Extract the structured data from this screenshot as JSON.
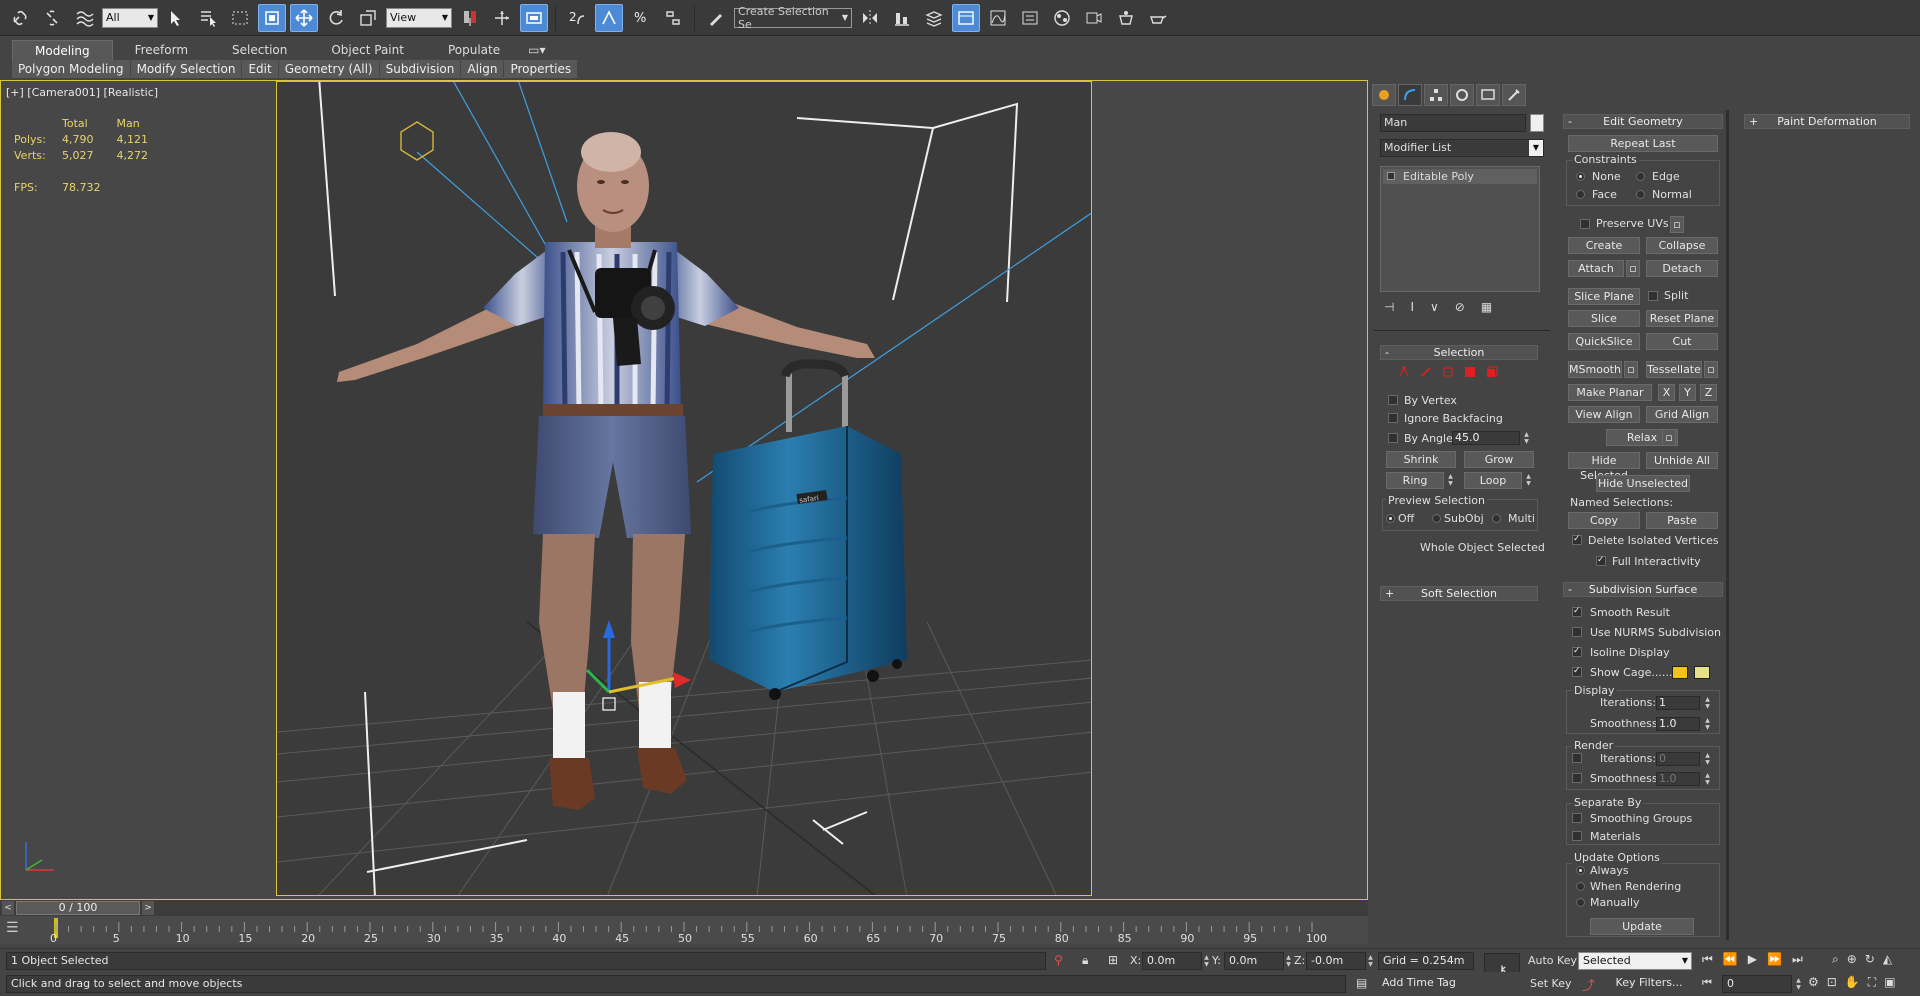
{
  "toolbar": {
    "selection_filter": "All",
    "reference_coord": "View",
    "named_selection_placeholder": "Create Selection Se"
  },
  "ribbon": {
    "tabs": [
      "Modeling",
      "Freeform",
      "Selection",
      "Object Paint",
      "Populate"
    ],
    "sub_items": [
      "Polygon Modeling",
      "Modify Selection",
      "Edit",
      "Geometry (All)",
      "Subdivision",
      "Align",
      "Properties"
    ]
  },
  "viewport": {
    "label": "[+] [Camera001] [Realistic]",
    "stats": {
      "col_total": "Total",
      "col_man": "Man",
      "polys_label": "Polys:",
      "polys_total": "4,790",
      "polys_man": "4,121",
      "verts_label": "Verts:",
      "verts_total": "5,027",
      "verts_man": "4,272",
      "fps_label": "FPS:",
      "fps_value": "78.732"
    },
    "suitcase_brand": "safari"
  },
  "command_panel": {
    "object_name": "Man",
    "modifier_list": "Modifier List",
    "stack_item": "Editable Poly",
    "selection": {
      "title": "Selection",
      "by_vertex": "By Vertex",
      "ignore_backfacing": "Ignore Backfacing",
      "by_angle": "By Angle:",
      "angle_value": "45.0",
      "shrink": "Shrink",
      "grow": "Grow",
      "ring": "Ring",
      "loop": "Loop",
      "preview_title": "Preview Selection",
      "preview_off": "Off",
      "preview_subobj": "SubObj",
      "preview_multi": "Multi",
      "status": "Whole Object Selected"
    },
    "soft_selection": "Soft Selection",
    "edit_geometry": {
      "title": "Edit Geometry",
      "repeat_last": "Repeat Last",
      "constraints": "Constraints",
      "none": "None",
      "edge": "Edge",
      "face": "Face",
      "normal": "Normal",
      "preserve_uvs": "Preserve UVs",
      "create": "Create",
      "collapse": "Collapse",
      "attach": "Attach",
      "detach": "Detach",
      "slice_plane": "Slice Plane",
      "split": "Split",
      "slice": "Slice",
      "reset_plane": "Reset Plane",
      "quickslice": "QuickSlice",
      "cut": "Cut",
      "msmooth": "MSmooth",
      "tessellate": "Tessellate",
      "make_planar": "Make Planar",
      "x": "X",
      "y": "Y",
      "z": "Z",
      "view_align": "View Align",
      "grid_align": "Grid Align",
      "relax": "Relax",
      "hide_selected": "Hide Selected",
      "unhide_all": "Unhide All",
      "hide_unselected": "Hide Unselected",
      "named_selections": "Named Selections:",
      "copy": "Copy",
      "paste": "Paste",
      "delete_isolated": "Delete Isolated Vertices",
      "full_interactivity": "Full Interactivity"
    },
    "subdivision_surface": {
      "title": "Subdivision Surface",
      "smooth_result": "Smooth Result",
      "use_nurms": "Use NURMS Subdivision",
      "isoline_display": "Isoline Display",
      "show_cage": "Show Cage......",
      "display": "Display",
      "iterations": "Iterations:",
      "display_iterations": "1",
      "smoothness": "Smoothness:",
      "display_smoothness": "1.0",
      "render": "Render",
      "render_iterations": "0",
      "render_smoothness": "1.0",
      "separate_by": "Separate By",
      "smoothing_groups": "Smoothing Groups",
      "materials": "Materials",
      "update_options": "Update Options",
      "always": "Always",
      "when_rendering": "When Rendering",
      "manually": "Manually",
      "update": "Update"
    },
    "paint_deformation": "Paint Deformation"
  },
  "timeline": {
    "position": "0 / 100",
    "ticks": [
      "0",
      "5",
      "10",
      "15",
      "20",
      "25",
      "30",
      "35",
      "40",
      "45",
      "50",
      "55",
      "60",
      "65",
      "70",
      "75",
      "80",
      "85",
      "90",
      "95",
      "100"
    ]
  },
  "status": {
    "selected": "1 Object Selected",
    "prompt": "Click and drag to select and move objects",
    "x_label": "X:",
    "x_value": "0.0m",
    "y_label": "Y:",
    "y_value": "0.0m",
    "z_label": "Z:",
    "z_value": "-0.0m",
    "grid": "Grid = 0.254m",
    "add_time_tag": "Add Time Tag",
    "auto_key": "Auto Key",
    "set_key": "Set Key",
    "selected_set": "Selected",
    "key_filters": "Key Filters...",
    "frame": "0"
  },
  "colors": {
    "viewport_border": "#d7c63a",
    "stats_text": "#e8d36a",
    "active_button": "#4d8ad6",
    "cage_color_1": "#f2c21b",
    "cage_color_2": "#e6e08a",
    "selection_red": "#e02020"
  }
}
